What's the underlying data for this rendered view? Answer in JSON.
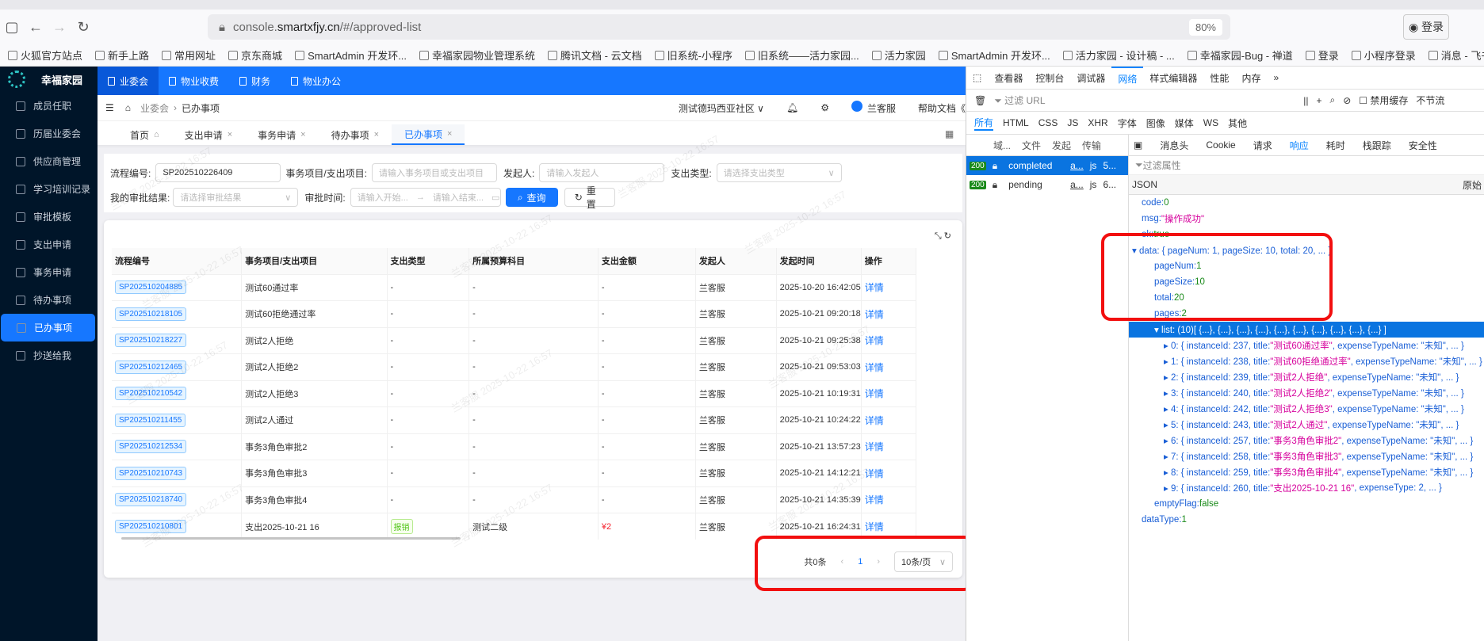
{
  "browser": {
    "url_prefix": "console.",
    "url_host": "smartxfjy.cn",
    "url_path": "/#/approved-list",
    "zoom": "80%",
    "login": "登录",
    "bookmarks": [
      "火狐官方站点",
      "新手上路",
      "常用网址",
      "京东商城",
      "SmartAdmin 开发环...",
      "幸福家园物业管理系统",
      "腾讯文档 - 云文档",
      "旧系统-小程序",
      "旧系统——活力家园...",
      "活力家园",
      "SmartAdmin 开发环...",
      "活力家园 - 设计稿 - ...",
      "幸福家园-Bug - 禅道",
      "登录",
      "小程序登录",
      "消息 - 飞书"
    ]
  },
  "app": {
    "brand": "幸福家园",
    "sidebar": [
      "成员任职",
      "历届业委会",
      "供应商管理",
      "学习培训记录",
      "审批模板",
      "支出申请",
      "事务申请",
      "待办事项",
      "已办事项",
      "抄送给我"
    ],
    "topnav": [
      "业委会",
      "物业收费",
      "财务",
      "物业办公"
    ],
    "breadcrumb": [
      "业委会",
      "已办事项"
    ],
    "community": "测试德玛西亚社区",
    "user": "兰客服",
    "help": "帮助文档",
    "tabs": [
      "首页",
      "支出申请",
      "事务申请",
      "待办事项",
      "已办事项"
    ],
    "filter": {
      "flow_no_label": "流程编号:",
      "flow_no_value": "SP202510226409",
      "item_label": "事务项目/支出项目:",
      "item_ph": "请输入事务项目或支出项目",
      "initiator_label": "发起人:",
      "initiator_ph": "请输入发起人",
      "type_label": "支出类型:",
      "type_ph": "请选择支出类型",
      "result_label": "我的审批结果:",
      "result_ph": "请选择审批结果",
      "time_label": "审批时间:",
      "start_ph": "请输入开始...",
      "end_ph": "请输入结束...",
      "query": "查询",
      "reset": "重置"
    },
    "table": {
      "headers": [
        "流程编号",
        "事务项目/支出项目",
        "支出类型",
        "所属预算科目",
        "支出金额",
        "发起人",
        "发起时间",
        "操作"
      ],
      "rows": [
        [
          "SP202510204885",
          "测试60通过率",
          "-",
          "-",
          "-",
          "兰客服",
          "2025-10-20 16:42:05",
          "详情"
        ],
        [
          "SP202510218105",
          "测试60拒绝通过率",
          "-",
          "-",
          "-",
          "兰客服",
          "2025-10-21 09:20:18",
          "详情"
        ],
        [
          "SP202510218227",
          "测试2人拒绝",
          "-",
          "-",
          "-",
          "兰客服",
          "2025-10-21 09:25:38",
          "详情"
        ],
        [
          "SP202510212465",
          "测试2人拒绝2",
          "-",
          "-",
          "-",
          "兰客服",
          "2025-10-21 09:53:03",
          "详情"
        ],
        [
          "SP202510210542",
          "测试2人拒绝3",
          "-",
          "-",
          "-",
          "兰客服",
          "2025-10-21 10:19:31",
          "详情"
        ],
        [
          "SP202510211455",
          "测试2人通过",
          "-",
          "-",
          "-",
          "兰客服",
          "2025-10-21 10:24:22",
          "详情"
        ],
        [
          "SP202510212534",
          "事务3角色审批2",
          "-",
          "-",
          "-",
          "兰客服",
          "2025-10-21 13:57:23",
          "详情"
        ],
        [
          "SP202510210743",
          "事务3角色审批3",
          "-",
          "-",
          "-",
          "兰客服",
          "2025-10-21 14:12:21",
          "详情"
        ],
        [
          "SP202510218740",
          "事务3角色审批4",
          "-",
          "-",
          "-",
          "兰客服",
          "2025-10-21 14:35:39",
          "详情"
        ],
        [
          "SP202510210801",
          "支出2025-10-21 16",
          "报销",
          "测试二级",
          "¥2",
          "兰客服",
          "2025-10-21 16:24:31",
          "详情"
        ]
      ]
    },
    "pager": {
      "total": "共0条",
      "page": "1",
      "size": "10条/页"
    },
    "watermark": "兰客服 2025-10-22 16:57"
  },
  "devtools": {
    "tools": [
      "查看器",
      "控制台",
      "调试器",
      "网络",
      "样式编辑器",
      "性能",
      "内存"
    ],
    "filter_url": "过滤 URL",
    "disable_cache": "禁用缓存",
    "throttle": "不节流",
    "types": [
      "所有",
      "HTML",
      "CSS",
      "JS",
      "XHR",
      "字体",
      "图像",
      "媒体",
      "WS",
      "其他"
    ],
    "cols": [
      "域...",
      "文件",
      "发起",
      "传输"
    ],
    "requests": [
      {
        "status": "200",
        "file": "completed",
        "init": "a...",
        "type": "js",
        "size": "5..."
      },
      {
        "status": "200",
        "file": "pending",
        "init": "a...",
        "type": "js",
        "size": "6..."
      }
    ],
    "detail_tabs": [
      "消息头",
      "Cookie",
      "请求",
      "响应",
      "耗时",
      "栈跟踪",
      "安全性"
    ],
    "filter_props": "过滤属性",
    "json_label": "JSON",
    "raw_label": "原始",
    "json_lines": [
      {
        "k": "code: ",
        "v": "0",
        "t": "n",
        "d": 0
      },
      {
        "k": "msg: ",
        "v": "\"操作成功\"",
        "t": "s",
        "d": 0
      },
      {
        "k": "ok: ",
        "v": "true",
        "t": "n",
        "d": 0
      },
      {
        "k": "▾ data: { pageNum: 1, pageSize: 10, total: 20, ... }",
        "v": "",
        "t": "",
        "d": -1
      },
      {
        "k": "pageNum: ",
        "v": "1",
        "t": "n",
        "d": 1
      },
      {
        "k": "pageSize: ",
        "v": "10",
        "t": "n",
        "d": 1
      },
      {
        "k": "total: ",
        "v": "20",
        "t": "n",
        "d": 1
      },
      {
        "k": "pages: ",
        "v": "2",
        "t": "n",
        "d": 1
      },
      {
        "k": "▾ list: (10)[ {...}, {...}, {...}, {...}, {...}, {...}, {...}, {...}, {...}, {...} ]",
        "v": "",
        "t": "",
        "d": 1,
        "sel": true
      },
      {
        "k": "▸ 0: { instanceId: 237, title: ",
        "v": "\"测试60通过率\"",
        "r": ", expenseTypeName: \"未知\", ... }",
        "t": "s",
        "d": 2
      },
      {
        "k": "▸ 1: { instanceId: 238, title: ",
        "v": "\"测试60拒绝通过率\"",
        "r": ", expenseTypeName: \"未知\", ... }",
        "t": "s",
        "d": 2
      },
      {
        "k": "▸ 2: { instanceId: 239, title: ",
        "v": "\"测试2人拒绝\"",
        "r": ", expenseTypeName: \"未知\", ... }",
        "t": "s",
        "d": 2
      },
      {
        "k": "▸ 3: { instanceId: 240, title: ",
        "v": "\"测试2人拒绝2\"",
        "r": ", expenseTypeName: \"未知\", ... }",
        "t": "s",
        "d": 2
      },
      {
        "k": "▸ 4: { instanceId: 242, title: ",
        "v": "\"测试2人拒绝3\"",
        "r": ", expenseTypeName: \"未知\", ... }",
        "t": "s",
        "d": 2
      },
      {
        "k": "▸ 5: { instanceId: 243, title: ",
        "v": "\"测试2人通过\"",
        "r": ", expenseTypeName: \"未知\", ... }",
        "t": "s",
        "d": 2
      },
      {
        "k": "▸ 6: { instanceId: 257, title: ",
        "v": "\"事务3角色审批2\"",
        "r": ", expenseTypeName: \"未知\", ... }",
        "t": "s",
        "d": 2
      },
      {
        "k": "▸ 7: { instanceId: 258, title: ",
        "v": "\"事务3角色审批3\"",
        "r": ", expenseTypeName: \"未知\", ... }",
        "t": "s",
        "d": 2
      },
      {
        "k": "▸ 8: { instanceId: 259, title: ",
        "v": "\"事务3角色审批4\"",
        "r": ", expenseTypeName: \"未知\", ... }",
        "t": "s",
        "d": 2
      },
      {
        "k": "▸ 9: { instanceId: 260, title: ",
        "v": "\"支出2025-10-21 16\"",
        "r": ", expenseType: 2, ... }",
        "t": "s",
        "d": 2
      },
      {
        "k": "emptyFlag: ",
        "v": "false",
        "t": "n",
        "d": 1
      },
      {
        "k": "dataType: ",
        "v": "1",
        "t": "n",
        "d": 0
      }
    ]
  }
}
